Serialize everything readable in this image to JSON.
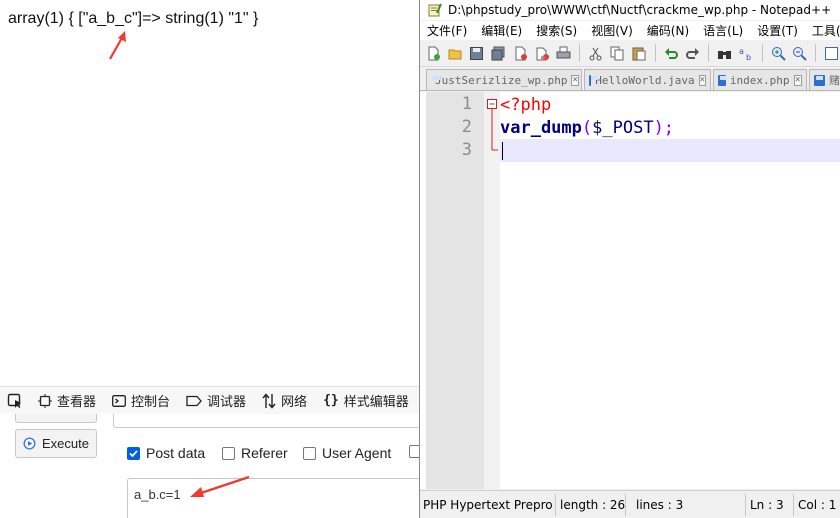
{
  "page": {
    "output_text": "array(1) { [\"a_b_c\"]=> string(1) \"1\" }"
  },
  "devtools": {
    "tabs": [
      {
        "label": "查看器",
        "icon": "inspector-icon"
      },
      {
        "label": "控制台",
        "icon": "console-icon"
      },
      {
        "label": "调试器",
        "icon": "debugger-icon"
      },
      {
        "label": "网络",
        "icon": "network-icon"
      },
      {
        "label": "样式编辑器",
        "icon": "style-editor-icon"
      }
    ]
  },
  "hackbar": {
    "execute_label": "Execute",
    "options": [
      {
        "label": "Post data",
        "checked": true
      },
      {
        "label": "Referer",
        "checked": false
      },
      {
        "label": "User Agent",
        "checked": false
      }
    ],
    "post_data_value": "a_b.c=1"
  },
  "npp": {
    "title": "D:\\phpstudy_pro\\WWW\\ctf\\Nuctf\\crackme_wp.php - Notepad++",
    "menu": [
      "文件(F)",
      "编辑(E)",
      "搜索(S)",
      "视图(V)",
      "编码(N)",
      "语言(L)",
      "设置(T)",
      "工具(O)"
    ],
    "tabs": [
      "JustSerizlize_wp.php",
      "HelloWorld.java",
      "index.php",
      "赌"
    ],
    "line_numbers": [
      "1",
      "2",
      "3"
    ],
    "code": {
      "line1": "<?php",
      "line2_fn": "var_dump",
      "line2_open": "(",
      "line2_var": "$_POST",
      "line2_close": ");"
    },
    "status": {
      "lang": "PHP Hypertext Prepro",
      "length": "length : 26",
      "lines": "lines : 3",
      "ln": "Ln : 3",
      "col": "Col : 1"
    }
  }
}
